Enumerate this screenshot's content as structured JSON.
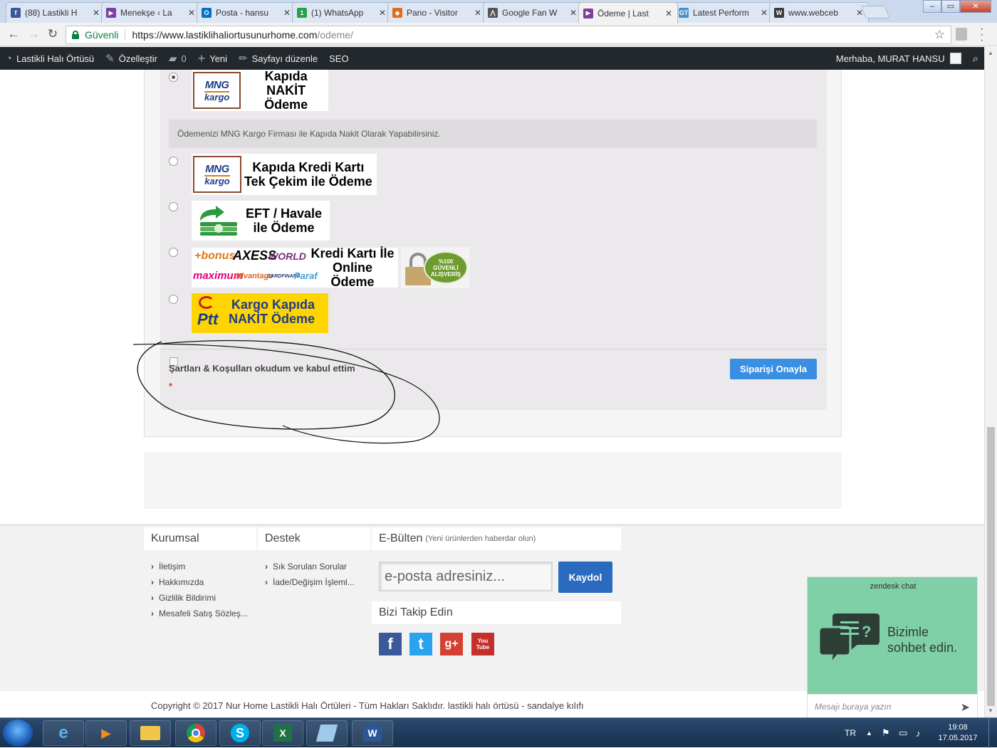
{
  "browser": {
    "tabs": [
      {
        "label": "(88) Lastikli H",
        "icon": "facebook-icon",
        "color": "#3b5998",
        "glyph": "f"
      },
      {
        "label": "Menekşe ‹ La",
        "icon": "wordpress-theme-icon",
        "color": "#7b3fa0",
        "glyph": "▶"
      },
      {
        "label": "Posta - hansu",
        "icon": "outlook-icon",
        "color": "#0072c6",
        "glyph": "O"
      },
      {
        "label": "(1) WhatsApp",
        "icon": "whatsapp-icon",
        "color": "#25a244",
        "glyph": "1"
      },
      {
        "label": "Pano - Visitor",
        "icon": "dashboard-icon",
        "color": "#e46b1e",
        "glyph": "◆"
      },
      {
        "label": "Google Fan W",
        "icon": "fan-icon",
        "color": "#555555",
        "glyph": "⋀"
      },
      {
        "label": "Ödeme | Last",
        "icon": "wordpress-theme-icon",
        "color": "#7b3fa0",
        "glyph": "▶"
      },
      {
        "label": "Latest Perform",
        "icon": "gtmetrix-icon",
        "color": "#4a8fc9",
        "glyph": "GT"
      },
      {
        "label": "www.webceb",
        "icon": "wordpress-icon",
        "color": "#3a3a3a",
        "glyph": "W"
      }
    ],
    "url_secure_label": "Güvenli",
    "url_scheme_host": "https://www.lastiklihaliortusunurhome.com",
    "url_path": "/odeme/"
  },
  "adminbar": {
    "site_name": "Lastikli Halı Örtüsü",
    "customize": "Özelleştir",
    "comments_count": "0",
    "new": "Yeni",
    "edit_page": "Sayfayı düzenle",
    "seo": "SEO",
    "greeting": "Merhaba, MURAT HANSU"
  },
  "payment": {
    "options": [
      {
        "id": "mng-cash",
        "line1": "Kapıda NAKİT",
        "line2": "Ödeme",
        "checked": true
      },
      {
        "id": "mng-card",
        "line1": "Kapıda Kredi Kartı",
        "line2": "Tek Çekim ile Ödeme",
        "checked": false
      },
      {
        "id": "eft",
        "line1": "EFT / Havale",
        "line2": "ile Ödeme",
        "checked": false
      },
      {
        "id": "card-online",
        "line1": "Kredi Kartı İle",
        "line2": "Online Ödeme",
        "checked": false
      },
      {
        "id": "ptt",
        "line1": "Kargo Kapıda",
        "line2": "NAKİT Ödeme",
        "checked": false
      }
    ],
    "mng_logo": {
      "top": "MNG",
      "bottom": "kargo"
    },
    "ptt_logo": "Ptt",
    "card_brands": [
      "+bonus",
      "AXESS",
      "WORLD",
      "maximum",
      "advantage",
      "CARDFINANS",
      "Paraf"
    ],
    "secure_badge": {
      "line1": "%100",
      "line2": "GÜVENLİ",
      "line3": "ALIŞVERİŞ"
    },
    "mng_cash_description": "Ödemenizi MNG Kargo Firması ile Kapıda Nakit Olarak Yapabilirsiniz.",
    "terms_label": "Şartları & Koşulları okudum ve kabul ettim",
    "required_mark": "*",
    "confirm_button": "Siparişi Onayla"
  },
  "footer": {
    "corporate": {
      "title": "Kurumsal",
      "links": [
        "İletişim",
        "Hakkımızda",
        "Gizlilik Bildirimi",
        "Mesafeli Satış Sözleş..."
      ]
    },
    "support": {
      "title": "Destek",
      "links": [
        "Sık Sorulan Sorular",
        "İade/Değişim İşleml..."
      ]
    },
    "newsletter": {
      "title": "E-Bülten",
      "subtitle": "(Yeni ürünlerden haberdar olun)",
      "placeholder": "e-posta adresiniz...",
      "button": "Kaydol"
    },
    "follow": {
      "title": "Bizi Takip Edin",
      "networks": [
        {
          "name": "facebook",
          "glyph": "f",
          "color": "#3b5998"
        },
        {
          "name": "twitter",
          "glyph": "t",
          "color": "#2aa3ef"
        },
        {
          "name": "google-plus",
          "glyph": "g+",
          "color": "#d44132"
        },
        {
          "name": "youtube",
          "glyph": "You Tube",
          "color": "#c4302b"
        }
      ]
    },
    "copyright": "Copyright © 2017 Nur Home Lastikli Halı Örtüleri - Tüm Hakları Saklıdır. lastikli halı örtüsü - sandalye kılıfı"
  },
  "zendesk": {
    "title": "zendesk chat",
    "message_line1": "Bizimle",
    "message_line2": "sohbet edin.",
    "input_placeholder": "Mesajı buraya yazın"
  },
  "taskbar": {
    "language": "TR",
    "time": "19:08",
    "date": "17.05.2017"
  },
  "colors": {
    "admin_bar": "#23282d",
    "confirm_button": "#3b8fe2",
    "newsletter_button": "#2a6bbf",
    "zendesk": "#7fcfa7",
    "required": "#e2401c"
  }
}
